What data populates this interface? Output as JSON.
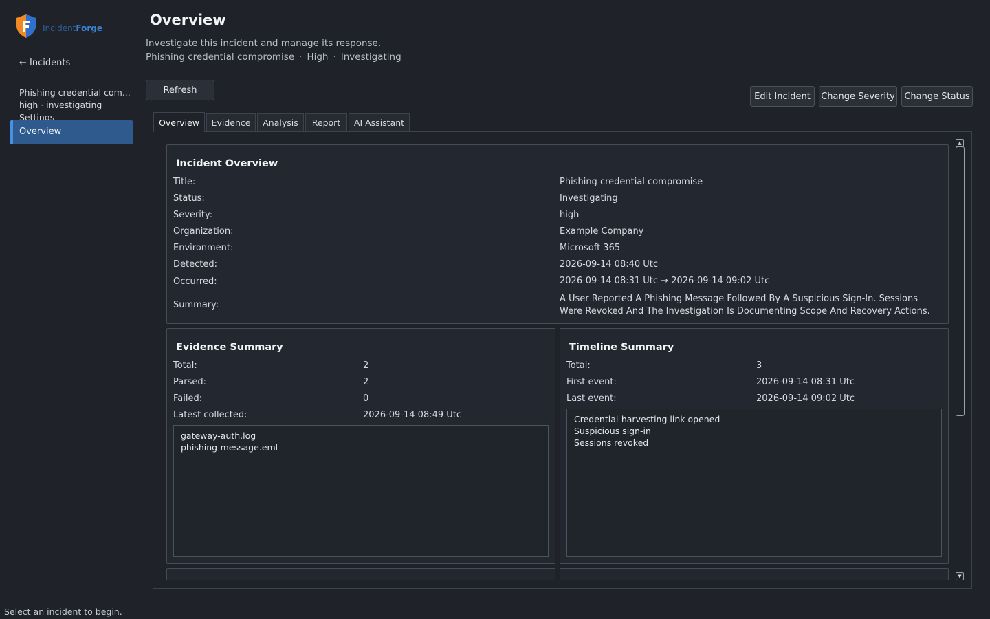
{
  "app": {
    "logo_part1": "Incident",
    "logo_part2": "Forge"
  },
  "sidebar": {
    "back_label": "← Incidents",
    "incident_title": "Phishing credential com...",
    "incident_meta": "high · investigating",
    "settings_label": "Settings",
    "active_item": "Overview"
  },
  "header": {
    "title": "Overview",
    "subtitle": "Investigate this incident and manage its response.",
    "incident_name": "Phishing credential compromise",
    "severity": "High",
    "status": "Investigating",
    "separator": "·"
  },
  "toolbar": {
    "refresh": "Refresh",
    "edit": "Edit Incident",
    "change_severity": "Change Severity",
    "change_status": "Change Status"
  },
  "tabs": [
    {
      "label": "Overview",
      "active": true
    },
    {
      "label": "Evidence",
      "active": false
    },
    {
      "label": "Analysis",
      "active": false
    },
    {
      "label": "Report",
      "active": false
    },
    {
      "label": "AI Assistant",
      "active": false
    }
  ],
  "incident_overview": {
    "heading": "Incident Overview",
    "fields": [
      {
        "label": "Title:",
        "value": "Phishing credential compromise"
      },
      {
        "label": "Status:",
        "value": "Investigating"
      },
      {
        "label": "Severity:",
        "value": "high"
      },
      {
        "label": "Organization:",
        "value": "Example Company"
      },
      {
        "label": "Environment:",
        "value": "Microsoft 365"
      },
      {
        "label": "Detected:",
        "value": "2026-09-14 08:40 Utc"
      },
      {
        "label": "Occurred:",
        "value": "2026-09-14 08:31 Utc → 2026-09-14 09:02 Utc"
      },
      {
        "label": "Summary:",
        "value": "A User Reported A Phishing Message Followed By A Suspicious Sign-In. Sessions Were Revoked And The Investigation Is Documenting Scope And Recovery Actions."
      }
    ]
  },
  "evidence_summary": {
    "heading": "Evidence Summary",
    "fields": [
      {
        "label": "Total:",
        "value": "2"
      },
      {
        "label": "Parsed:",
        "value": "2"
      },
      {
        "label": "Failed:",
        "value": "0"
      },
      {
        "label": "Latest collected:",
        "value": "2026-09-14 08:49 Utc"
      }
    ],
    "files": [
      "gateway-auth.log",
      "phishing-message.eml"
    ]
  },
  "timeline_summary": {
    "heading": "Timeline Summary",
    "fields": [
      {
        "label": "Total:",
        "value": "3"
      },
      {
        "label": "First event:",
        "value": "2026-09-14 08:31 Utc"
      },
      {
        "label": "Last event:",
        "value": "2026-09-14 09:02 Utc"
      }
    ],
    "events": [
      "Credential-harvesting link opened",
      "Suspicious sign-in",
      "Sessions revoked"
    ]
  },
  "status_bar": "Select an incident to begin.",
  "colors": {
    "background": "#1f2329",
    "accent": "#2e5a8e",
    "logo_orange": "#f08a24",
    "logo_blue": "#2f6fd0"
  }
}
